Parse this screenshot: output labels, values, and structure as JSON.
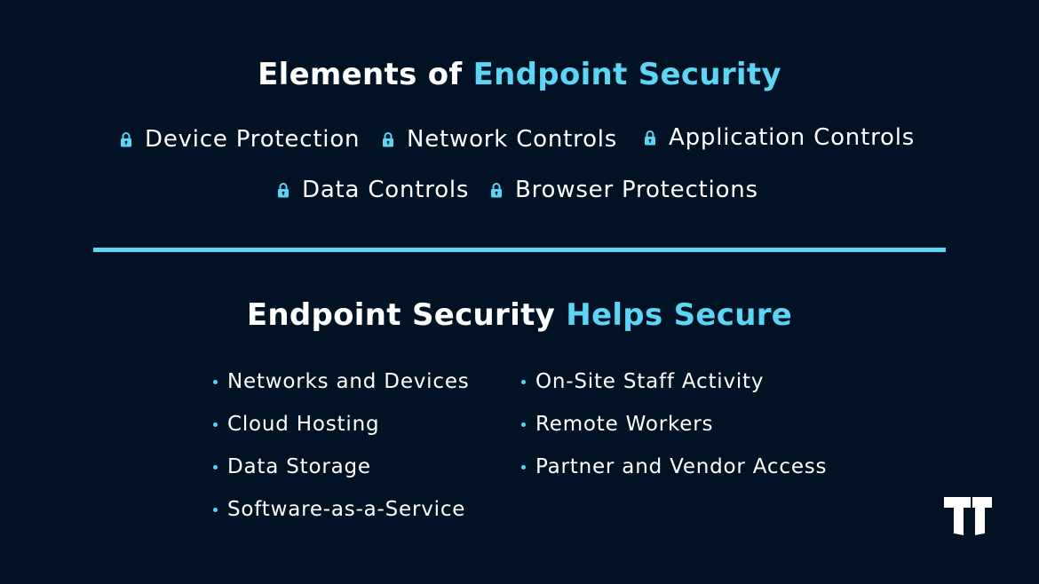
{
  "section1": {
    "title_plain": "Elements of ",
    "title_accent": "Endpoint Security",
    "row1": [
      "Device Protection",
      "Network Controls",
      "Application Controls"
    ],
    "row2": [
      "Data Controls",
      "Browser Protections"
    ],
    "item_icon": "lock-icon"
  },
  "section2": {
    "title_plain": "Endpoint Security ",
    "title_accent": "Helps Secure",
    "left_column": [
      "Networks and Devices",
      "Cloud Hosting",
      "Data Storage",
      "Software-as-a-Service"
    ],
    "right_column": [
      "On-Site Staff Activity",
      "Remote Workers",
      "Partner and Vendor Access"
    ]
  },
  "logo": {
    "icon": "tt-logo-icon"
  },
  "colors": {
    "background": "#011224",
    "accent": "#5dd6f5",
    "text": "#ffffff"
  }
}
